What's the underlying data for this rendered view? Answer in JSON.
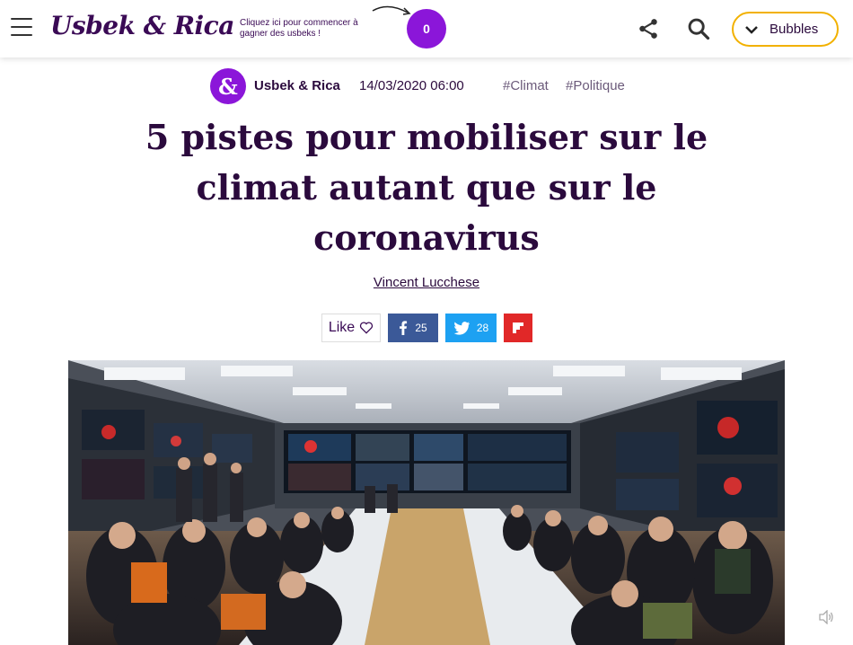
{
  "header": {
    "logo": "Usbek & Rica",
    "promo": "Cliquez ici pour commencer à gagner des usbeks !",
    "counter": "0",
    "bubbles_label": "Bubbles"
  },
  "meta": {
    "author_initial": "&",
    "author": "Usbek & Rica",
    "date": "14/03/2020 06:00",
    "tags": [
      "#Climat",
      "#Politique"
    ]
  },
  "article": {
    "title": "5 pistes pour mobiliser sur le climat autant que sur le coronavirus",
    "author_link": "Vincent Lucchese"
  },
  "social": {
    "like_label": "Like",
    "facebook_count": "25",
    "twitter_count": "28"
  },
  "colors": {
    "brand": "#3a0a55",
    "accent": "#8b16d9",
    "bubbles_border": "#f2b100",
    "facebook": "#3b5998",
    "twitter": "#1da1f2",
    "flipboard": "#e12828"
  }
}
